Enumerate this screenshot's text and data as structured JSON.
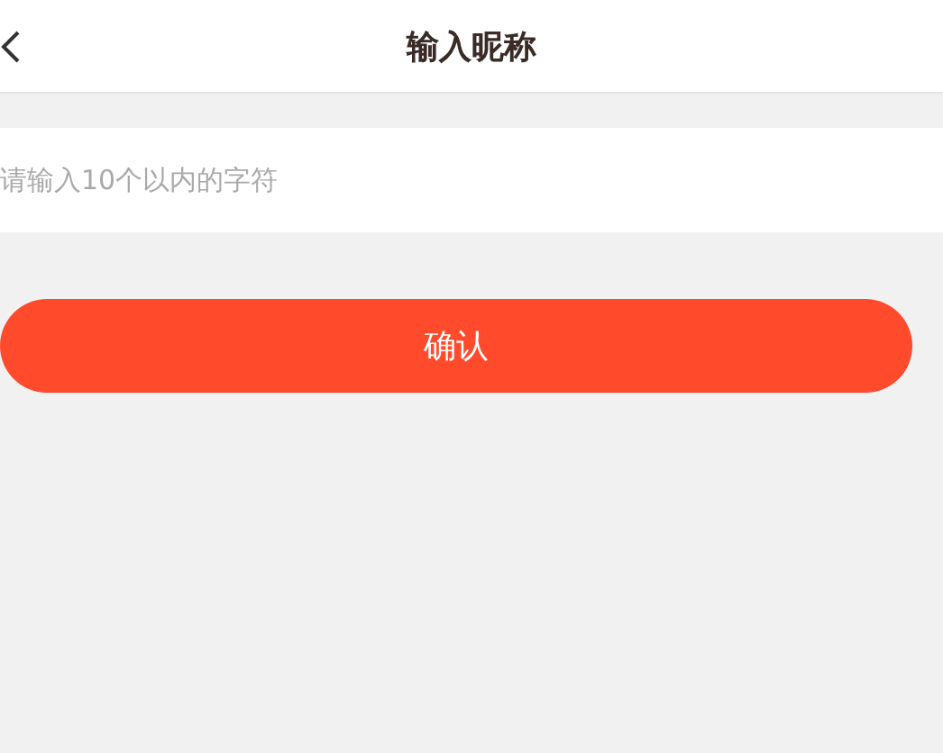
{
  "header": {
    "title": "输入昵称"
  },
  "nickname_field": {
    "placeholder": "请输入10个以内的字符"
  },
  "confirm_button": {
    "label": "确认"
  }
}
